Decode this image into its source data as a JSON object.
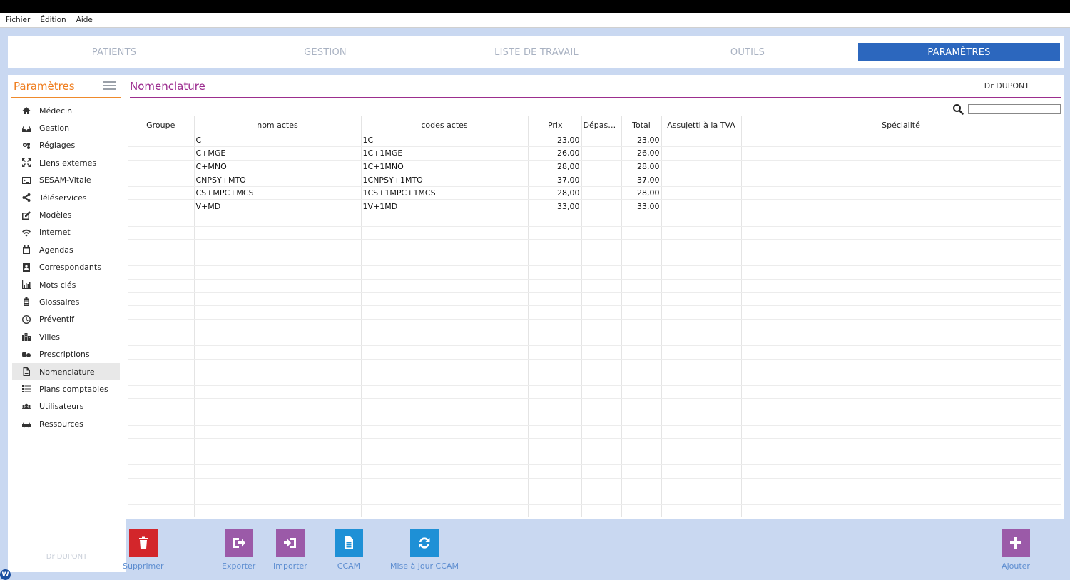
{
  "menu": {
    "items": [
      "Fichier",
      "Édition",
      "Aide"
    ]
  },
  "tabs": [
    {
      "label": "PATIENTS"
    },
    {
      "label": "GESTION"
    },
    {
      "label": "LISTE DE TRAVAIL"
    },
    {
      "label": "OUTILS"
    },
    {
      "label": "PARAMÈTRES",
      "active": true
    }
  ],
  "sidebar": {
    "title": "Paramètres",
    "footer": "Dr DUPONT",
    "items": [
      {
        "label": "Médecin",
        "icon": "home-icon"
      },
      {
        "label": "Gestion",
        "icon": "inbox-icon"
      },
      {
        "label": "Réglages",
        "icon": "gears-icon"
      },
      {
        "label": "Liens externes",
        "icon": "expand-icon"
      },
      {
        "label": "SESAM-Vitale",
        "icon": "card-terminal-icon"
      },
      {
        "label": "Téléservices",
        "icon": "share-icon"
      },
      {
        "label": "Modèles",
        "icon": "edit-icon"
      },
      {
        "label": "Internet",
        "icon": "wifi-icon"
      },
      {
        "label": "Agendas",
        "icon": "calendar-icon"
      },
      {
        "label": "Correspondants",
        "icon": "contact-book-icon"
      },
      {
        "label": "Mots clés",
        "icon": "bar-chart-icon"
      },
      {
        "label": "Glossaires",
        "icon": "clipboard-icon"
      },
      {
        "label": "Préventif",
        "icon": "clock-icon"
      },
      {
        "label": "Villes",
        "icon": "city-icon"
      },
      {
        "label": "Prescriptions",
        "icon": "pills-icon"
      },
      {
        "label": "Nomenclature",
        "icon": "document-icon",
        "active": true
      },
      {
        "label": "Plans comptables",
        "icon": "list-icon"
      },
      {
        "label": "Utilisateurs",
        "icon": "users-icon"
      },
      {
        "label": "Ressources",
        "icon": "car-icon"
      }
    ]
  },
  "main": {
    "title": "Nomenclature",
    "doctor": "Dr DUPONT",
    "search": {
      "value": "",
      "placeholder": ""
    }
  },
  "table": {
    "columns": [
      "Groupe",
      "nom actes",
      "codes actes",
      "Prix",
      "Dépasse...",
      "Total",
      "Assujetti à la TVA",
      "Spécialité"
    ],
    "rows": [
      [
        "",
        "C",
        "1C",
        "23,00",
        "",
        "23,00",
        "",
        ""
      ],
      [
        "",
        "C+MGE",
        "1C+1MGE",
        "26,00",
        "",
        "26,00",
        "",
        ""
      ],
      [
        "",
        "C+MNO",
        "1C+1MNO",
        "28,00",
        "",
        "28,00",
        "",
        ""
      ],
      [
        "",
        "CNPSY+MTO",
        "1CNPSY+1MTO",
        "37,00",
        "",
        "37,00",
        "",
        ""
      ],
      [
        "",
        "CS+MPC+MCS",
        "1CS+1MPC+1MCS",
        "28,00",
        "",
        "28,00",
        "",
        ""
      ],
      [
        "",
        "V+MD",
        "1V+1MD",
        "33,00",
        "",
        "33,00",
        "",
        ""
      ]
    ]
  },
  "toolbar": {
    "delete": "Supprimer",
    "export": "Exporter",
    "import": "Importer",
    "ccam": "CCAM",
    "update_ccam": "Mise à jour CCAM",
    "add": "Ajouter"
  },
  "colors": {
    "accent_blue": "#2c67be",
    "sidebar_orange": "#ef7c1c",
    "title_purple": "#9b2a8e",
    "delete_red": "#d3262b",
    "action_purple": "#9b5aa8",
    "action_blue": "#1e90d6",
    "background": "#c9d8f1"
  }
}
